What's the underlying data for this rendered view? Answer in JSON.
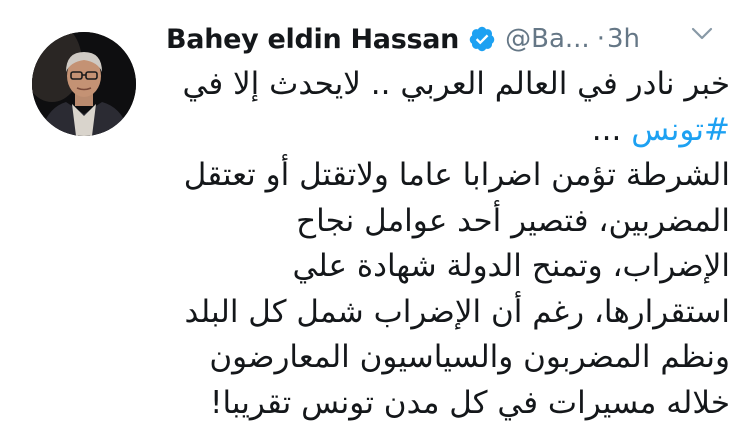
{
  "tweet": {
    "author": {
      "display_name": "Bahey eldin Hassan",
      "handle": "@Ba...",
      "verified": true
    },
    "separator": "·",
    "time": "3h",
    "line1": "خبر نادر في العالم العربي .. لايحدث إلا في",
    "hashtag": "#تونس",
    "line2_suffix": " ...",
    "line3": "الشرطة تؤمن اضرابا عاما ولاتقتل أو تعتقل",
    "line4": "المضربين، فتصير أحد عوامل نجاح",
    "line5": "الإضراب، وتمنح الدولة شهادة علي",
    "line6": "استقرارها، رغم أن الإضراب شمل كل البلد",
    "line7": "ونظم المضربون والسياسيون المعارضون",
    "line8": "خلاله مسيرات في كل مدن تونس تقريبا!"
  },
  "icons": {
    "verified": "verified-badge-icon",
    "menu": "chevron-down-icon"
  },
  "colors": {
    "text": "#14171a",
    "secondary": "#657786",
    "accent": "#1da1f2"
  }
}
